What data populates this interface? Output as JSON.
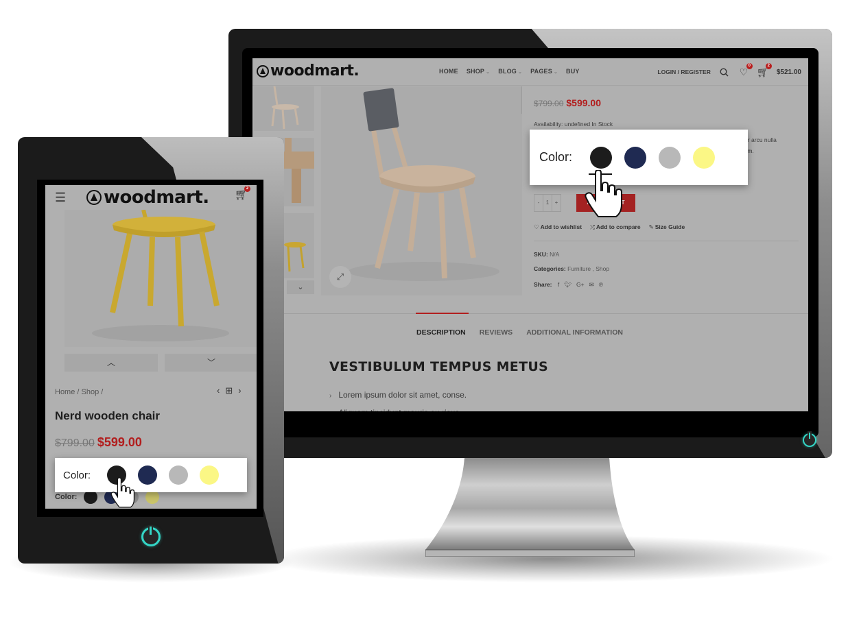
{
  "brand": {
    "name": "woodmart.",
    "accent": "#b21e1e",
    "power_accent": "#34d6c6"
  },
  "desktop": {
    "nav": [
      {
        "label": "HOME",
        "has_dropdown": false
      },
      {
        "label": "SHOP",
        "has_dropdown": true
      },
      {
        "label": "BLOG",
        "has_dropdown": true
      },
      {
        "label": "PAGES",
        "has_dropdown": true
      },
      {
        "label": "BUY",
        "has_dropdown": false
      }
    ],
    "login_label": "LOGIN / REGISTER",
    "wishlist_count": "0",
    "cart_count": "2",
    "cart_total": "$521.00",
    "price_old": "$799.00",
    "price_new": "$599.00",
    "availability": "Availability: undefined In Stock",
    "description_fragment": [
      "etur arcu nulla",
      "ulum."
    ],
    "quantity": {
      "minus": "-",
      "value": "1",
      "plus": "+"
    },
    "add_to_cart_label": "ADD TO CART",
    "actions": [
      {
        "icon": "heart-icon",
        "glyph": "♡",
        "label": "Add to wishlist"
      },
      {
        "icon": "shuffle-icon",
        "glyph": "⤮",
        "label": "Add to compare"
      },
      {
        "icon": "ruler-icon",
        "glyph": "✎",
        "label": "Size Guide"
      }
    ],
    "sku_label": "SKU:",
    "sku_value": "N/A",
    "categories_label": "Categories:",
    "categories_value": "Furniture , Shop",
    "share_label": "Share:",
    "share_icons": [
      {
        "name": "facebook-icon",
        "glyph": "f"
      },
      {
        "name": "twitter-icon",
        "glyph": "🐦︎"
      },
      {
        "name": "google-plus-icon",
        "glyph": "G+"
      },
      {
        "name": "email-icon",
        "glyph": "✉"
      },
      {
        "name": "pinterest-icon",
        "glyph": "℗"
      }
    ],
    "tabs": [
      {
        "label": "DESCRIPTION",
        "active": true
      },
      {
        "label": "REVIEWS",
        "active": false
      },
      {
        "label": "ADDITIONAL INFORMATION",
        "active": false
      }
    ],
    "content_title": "VESTIBULUM TEMPUS METUS",
    "content_list": [
      "Lorem ipsum dolor sit amet, conse.",
      "Aliquam tincidunt mauris eu risus."
    ]
  },
  "color_picker": {
    "label": "Color:",
    "swatches": [
      {
        "name": "black",
        "hex": "#1c1c1c",
        "selected": true
      },
      {
        "name": "navy",
        "hex": "#1f2a52",
        "selected": false
      },
      {
        "name": "gray",
        "hex": "#b8b8b8",
        "selected": false
      },
      {
        "name": "yellow",
        "hex": "#fbf785",
        "selected": false
      }
    ]
  },
  "tablet": {
    "cart_count": "2",
    "breadcrumb": "Home /  Shop  /",
    "product_title": "Nerd wooden chair",
    "price_old": "$799.00",
    "price_new": "$599.00",
    "color_label": "Color:",
    "underlying_swatches": [
      "#1c1c1c",
      "#1f2a52",
      "#8c8c8c",
      "#c9c46a"
    ]
  }
}
